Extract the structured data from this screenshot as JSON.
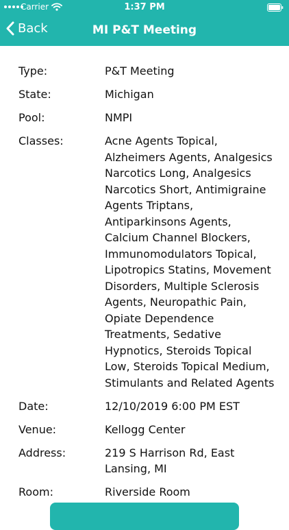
{
  "status_bar": {
    "carrier": "Carrier",
    "time": "1:37 PM"
  },
  "nav": {
    "back_label": "Back",
    "title": "MI P&T Meeting"
  },
  "details": {
    "type_label": "Type:",
    "type_value": "P&T Meeting",
    "state_label": "State:",
    "state_value": "Michigan",
    "pool_label": "Pool:",
    "pool_value": "NMPI",
    "classes_label": "Classes:",
    "classes_value": "Acne Agents Topical, Alzheimers Agents, Analgesics Narcotics Long, Analgesics Narcotics Short, Antimigraine Agents Triptans, Antiparkinsons Agents, Calcium Channel Blockers, Immunomodulators Topical, Lipotropics Statins, Movement Disorders, Multiple Sclerosis Agents, Neuropathic Pain, Opiate Dependence Treatments, Sedative Hypnotics, Steroids Topical Low, Steroids Topical Medium, Stimulants and Related Agents",
    "date_label": "Date:",
    "date_value": "12/10/2019 6:00 PM EST",
    "venue_label": "Venue:",
    "venue_value": "Kellogg Center",
    "address_label": "Address:",
    "address_value": "219 S Harrison Rd, East Lansing, MI",
    "room_label": "Room:",
    "room_value": "Riverside Room"
  },
  "colors": {
    "accent": "#22b5ad",
    "text": "#111111",
    "background": "#ffffff"
  },
  "icons": {
    "back": "chevron-left-icon",
    "wifi": "wifi-icon",
    "battery": "battery-icon",
    "signal": "signal-dots-icon"
  }
}
